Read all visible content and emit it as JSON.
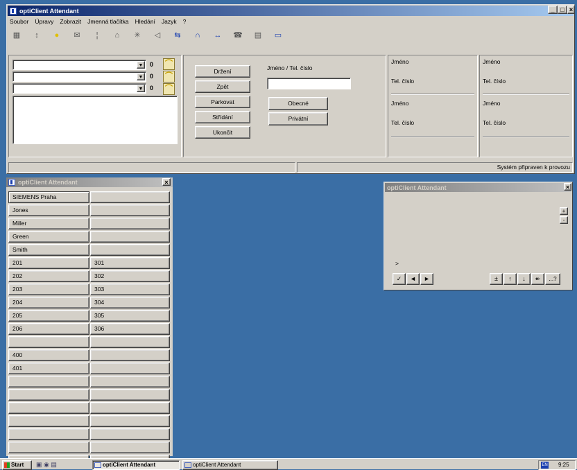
{
  "main_window": {
    "title": "optiClient Attendant",
    "menu": [
      "Soubor",
      "Úpravy",
      "Zobrazit",
      "Jmenná tlačítka",
      "Hledání",
      "Jazyk",
      "?"
    ],
    "toolbar_icons": [
      "keypad-icon",
      "pin-icon",
      "bulb-icon",
      "envelope-icon",
      "pin-icon",
      "hands-icon",
      "spark-icon",
      "speaker-icon",
      "transfer-icon",
      "headset-icon",
      "arrows-icon",
      "phonebook-icon",
      "folder-icon",
      "screen-icon"
    ],
    "lines": [
      {
        "count": "0"
      },
      {
        "count": "0"
      },
      {
        "count": "0"
      }
    ],
    "buttons": [
      "Držení",
      "Zpět",
      "Parkovat",
      "Střídání",
      "Ukončit"
    ],
    "name_number_label": "Jméno / Tel. číslo",
    "name_number_value": "",
    "obecne_button": "Obecné",
    "privatni_button": "Privátní",
    "contact_cards": [
      {
        "name": "Jméno",
        "phone": "Tel. číslo"
      },
      {
        "name": "Jméno",
        "phone": "Tel. číslo"
      },
      {
        "name": "Jméno",
        "phone": "Tel. číslo"
      },
      {
        "name": "Jméno",
        "phone": "Tel. číslo"
      }
    ],
    "status_text": "Systém připraven k provozu"
  },
  "list_window": {
    "title": "optiClient Attendant",
    "rows": [
      [
        "SIEMENS Praha",
        ""
      ],
      [
        "Jones",
        ""
      ],
      [
        "Miller",
        ""
      ],
      [
        "Green",
        ""
      ],
      [
        "Smith",
        ""
      ],
      [
        "201",
        "301"
      ],
      [
        "202",
        "302"
      ],
      [
        "203",
        "303"
      ],
      [
        "204",
        "304"
      ],
      [
        "205",
        "305"
      ],
      [
        "206",
        "306"
      ],
      [
        "",
        ""
      ],
      [
        "400",
        ""
      ],
      [
        "401",
        ""
      ],
      [
        "",
        ""
      ],
      [
        "",
        ""
      ],
      [
        "",
        ""
      ],
      [
        "",
        ""
      ],
      [
        "",
        ""
      ],
      [
        "",
        ""
      ],
      [
        "",
        ""
      ]
    ]
  },
  "small_window": {
    "title": "optiClient Attendant",
    "prompt": ">",
    "left_buttons": [
      "✓",
      "◄",
      "►"
    ],
    "right_buttons": [
      "±",
      "↑",
      "↓",
      "↞",
      "...?"
    ]
  },
  "taskbar": {
    "start_label": "Start",
    "tasks": [
      "optiClient Attendant",
      "optiClient Attendant"
    ],
    "lang": "EN",
    "clock": "9:25"
  }
}
